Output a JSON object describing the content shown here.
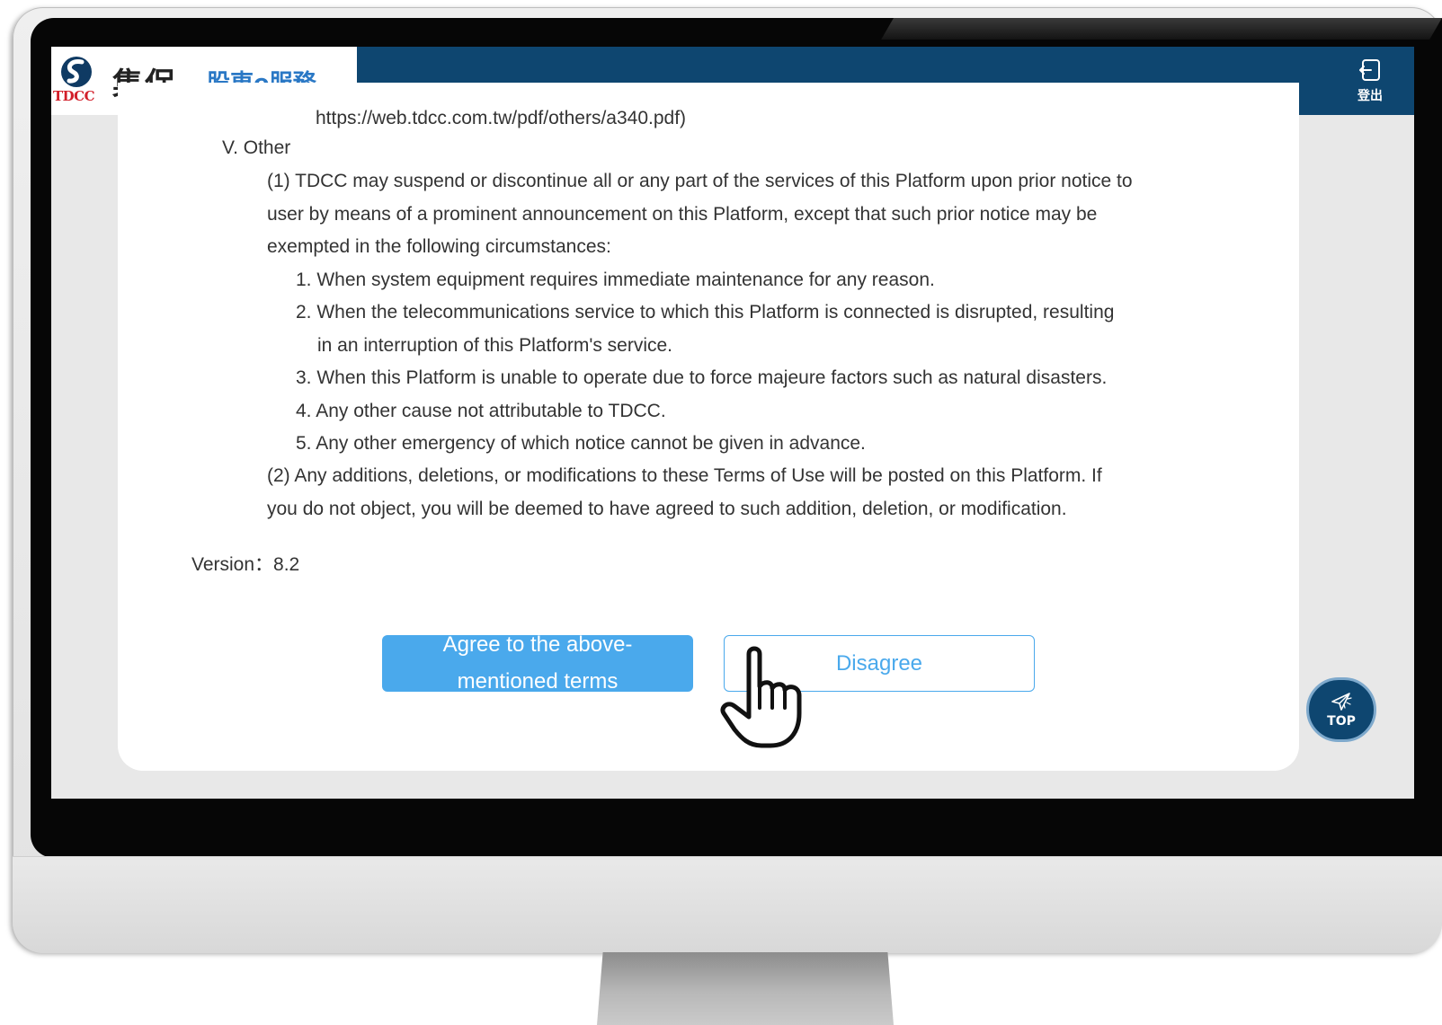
{
  "header": {
    "logo_text": "TDCC",
    "logo_chinese": "集保",
    "service_name": "股東e服務",
    "logout_label": "登出",
    "logout_icon": "logout-icon",
    "background_color": "#0e4670",
    "service_color": "#2a78c5",
    "logo_red": "#d21f2a"
  },
  "terms": {
    "url_line": "https://web.tdcc.com.tw/pdf/others/a340.pdf)",
    "section_title": "V. Other",
    "para1": [
      "(1) TDCC may suspend or discontinue all or any part of the services of this Platform upon prior notice to",
      "user by means of a prominent announcement on this Platform, except that such prior notice may be",
      "exempted in the following circumstances:"
    ],
    "items": [
      "1. When system equipment requires immediate maintenance for any reason.",
      "2. When the telecommunications service to which this Platform is connected is disrupted, resulting",
      "in an interruption of this Platform's service.",
      "3. When this Platform is unable to operate due to force majeure factors such as natural disasters.",
      "4. Any other cause not attributable to TDCC.",
      "5. Any other emergency of which notice cannot be given in advance."
    ],
    "para2": [
      "(2) Any additions, deletions, or modifications to these Terms of Use will be posted on this Platform. If",
      "you do not object, you will be deemed to have agreed to such addition, deletion, or modification."
    ],
    "version": "Version：8.2"
  },
  "buttons": {
    "agree_label": "Agree to the above-mentioned terms",
    "disagree_label": "Disagree",
    "accent_color": "#4aa9ec"
  },
  "top_button": {
    "label": "TOP",
    "icon": "paper-plane-icon"
  },
  "cursor": {
    "icon": "pointing-hand-icon"
  }
}
